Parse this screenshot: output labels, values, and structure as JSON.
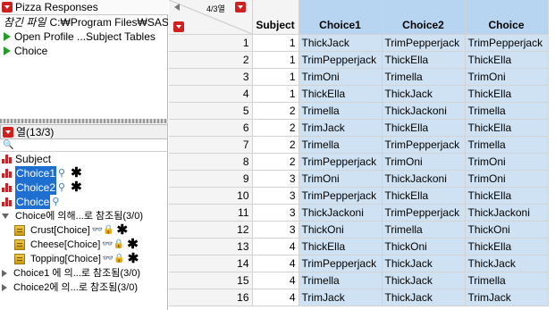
{
  "table_panel": {
    "title": "Pizza Responses",
    "source_label": "참긴 파일",
    "source_path": "C:₩Program Files₩SAS",
    "scripts": [
      "Open Profile ...Subject Tables",
      "Choice"
    ]
  },
  "columns_panel": {
    "title": "열(13/3)",
    "search_placeholder": "🔍",
    "columns": [
      {
        "name": "Subject",
        "selected": false
      },
      {
        "name": "Choice1",
        "selected": true
      },
      {
        "name": "Choice2",
        "selected": true
      },
      {
        "name": "Choice",
        "selected": true
      }
    ],
    "ref_groups": [
      {
        "label": "Choice에 의해...로 참조됨(3/0)",
        "expanded": true,
        "items": [
          "Crust[Choice]",
          "Cheese[Choice]",
          "Topping[Choice]"
        ]
      },
      {
        "label": "Choice1 에 의...로 참조됨(3/0)",
        "expanded": false
      },
      {
        "label": "Choice2에 의...로 참조됨(3/0)",
        "expanded": false
      }
    ]
  },
  "grid": {
    "row_count_label": "4/3열",
    "headers": [
      "Subject",
      "Choice1",
      "Choice2",
      "Choice"
    ],
    "rows": [
      [
        1,
        1,
        "ThickJack",
        "TrimPepperjack",
        "TrimPepperjack"
      ],
      [
        2,
        1,
        "TrimPepperjack",
        "ThickElla",
        "ThickElla"
      ],
      [
        3,
        1,
        "TrimOni",
        "Trimella",
        "TrimOni"
      ],
      [
        4,
        1,
        "ThickElla",
        "ThickJack",
        "ThickElla"
      ],
      [
        5,
        2,
        "Trimella",
        "ThickJackoni",
        "Trimella"
      ],
      [
        6,
        2,
        "TrimJack",
        "ThickElla",
        "ThickElla"
      ],
      [
        7,
        2,
        "Trimella",
        "TrimPepperjack",
        "Trimella"
      ],
      [
        8,
        2,
        "TrimPepperjack",
        "TrimOni",
        "TrimOni"
      ],
      [
        9,
        3,
        "TrimOni",
        "ThickJackoni",
        "TrimOni"
      ],
      [
        10,
        3,
        "TrimPepperjack",
        "ThickElla",
        "ThickElla"
      ],
      [
        11,
        3,
        "ThickJackoni",
        "TrimPepperjack",
        "ThickJackoni"
      ],
      [
        12,
        3,
        "ThickOni",
        "Trimella",
        "ThickOni"
      ],
      [
        13,
        4,
        "ThickElla",
        "ThickOni",
        "ThickElla"
      ],
      [
        14,
        4,
        "TrimPepperjack",
        "ThickJack",
        "ThickJack"
      ],
      [
        15,
        4,
        "Trimella",
        "ThickJack",
        "Trimella"
      ],
      [
        16,
        4,
        "TrimJack",
        "ThickJack",
        "TrimJack"
      ]
    ]
  }
}
